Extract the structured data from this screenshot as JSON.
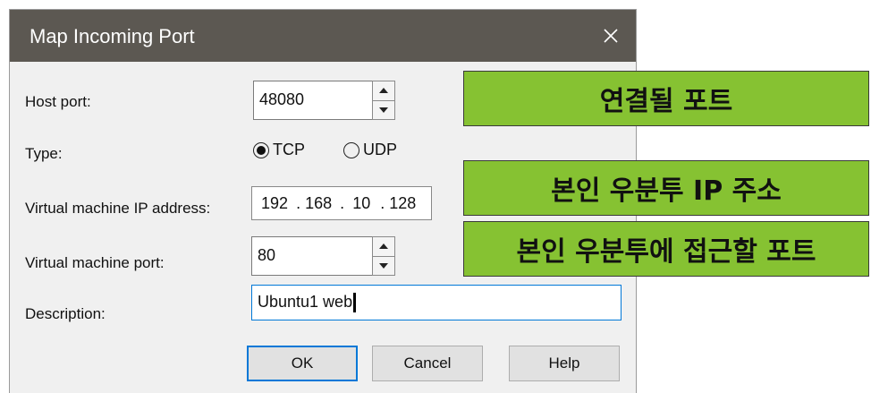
{
  "dialog": {
    "title": "Map Incoming Port",
    "close_icon": "close-icon",
    "host_port": {
      "label": "Host port:",
      "value": "48080"
    },
    "type": {
      "label": "Type:",
      "options": [
        {
          "label": "TCP",
          "selected": true
        },
        {
          "label": "UDP",
          "selected": false
        }
      ]
    },
    "vm_ip": {
      "label": "Virtual machine IP address:",
      "octets": [
        "192",
        "168",
        "10",
        "128"
      ],
      "separator": "."
    },
    "vm_port": {
      "label": "Virtual machine port:",
      "value": "80"
    },
    "description": {
      "label": "Description:",
      "value": "Ubuntu1 web"
    },
    "buttons": {
      "ok": "OK",
      "cancel": "Cancel",
      "help": "Help"
    }
  },
  "callouts": {
    "host_port": "연결될 포트",
    "vm_ip": "본인 우분투 IP 주소",
    "vm_port": "본인 우분투에 접근할 포트"
  },
  "colors": {
    "titlebar": "#5c5852",
    "callout": "#86c232",
    "focus": "#0078d7"
  }
}
